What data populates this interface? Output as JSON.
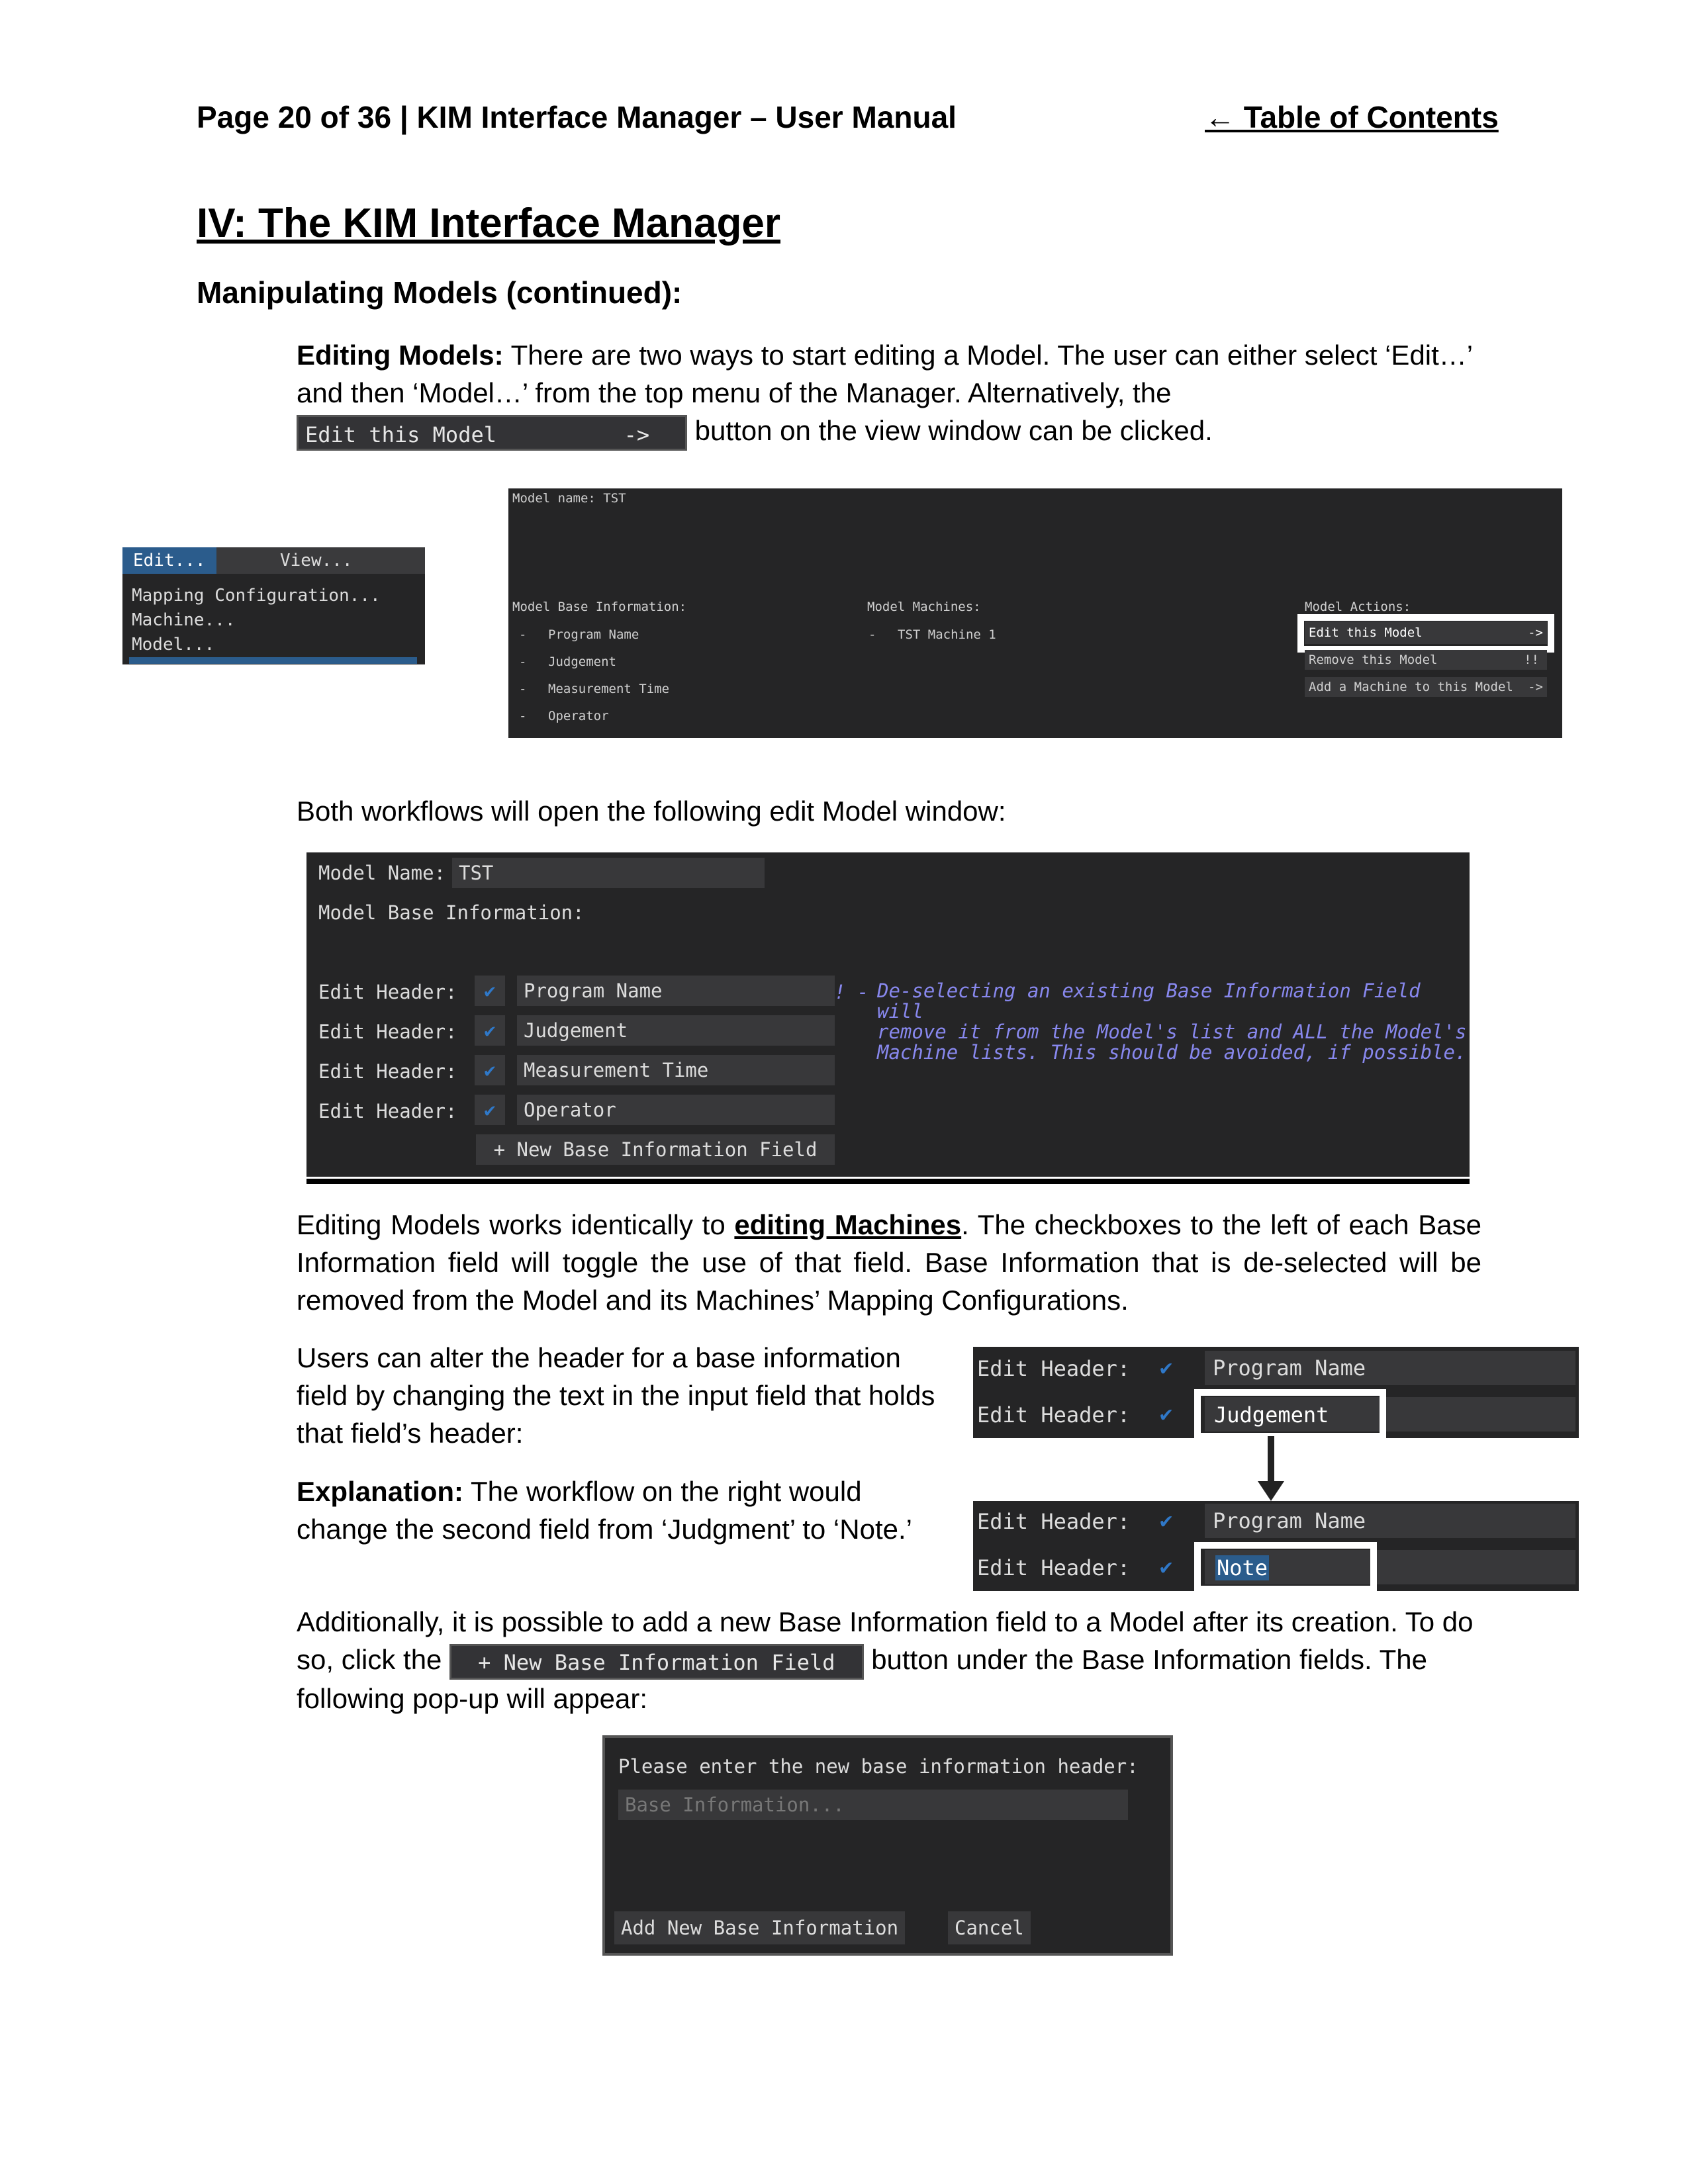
{
  "header": {
    "page_label": "Page 20 of 36 | KIM Interface Manager – User Manual",
    "toc_link": "← Table of Contents"
  },
  "section_title": "IV: The KIM Interface Manager",
  "subsection_title": "Manipulating Models (continued):",
  "editing_models": {
    "lead": "Editing Models:",
    "text1": " There are two ways to start editing a Model. The user can either select ‘Edit…’ and then ‘Model…’ from the top menu of the Manager. Alternatively, the",
    "inline_button": "Edit this Model          ->",
    "text2": " button on the view window can be clicked."
  },
  "edit_menu": {
    "tab_edit": "Edit...",
    "tab_view": "View...",
    "items": [
      "Mapping Configuration...",
      "Machine...",
      "Model..."
    ]
  },
  "view_window": {
    "model_name": "Model name: TST",
    "base_heading": "Model Base Information:",
    "base_items": [
      "Program Name",
      "Judgement",
      "Measurement Time",
      "Operator"
    ],
    "bullet": "-",
    "machines_heading": "Model Machines:",
    "machine_items": [
      "TST Machine 1"
    ],
    "actions_heading": "Model Actions:",
    "actions": [
      "Edit this Model",
      "Remove this Model",
      "Add a Machine to this Model"
    ],
    "action_suffixes": [
      "->",
      "!!",
      "->"
    ]
  },
  "both_workflows": "Both workflows will open the following edit Model window:",
  "edit_window": {
    "name_label": "Model Name:",
    "name_value": "TST",
    "base_heading": "Model Base Information:",
    "row_label": "Edit Header:",
    "rows": [
      "Program Name",
      "Judgement",
      "Measurement Time",
      "Operator"
    ],
    "check_glyph": "✔",
    "warning_prefix": "! -",
    "warning_lines": [
      "De-selecting an existing Base Information Field will",
      "remove it from the Model's list and ALL the Model's",
      "Machine lists. This should be avoided, if possible."
    ],
    "new_field_button": "+ New Base Information Field"
  },
  "identical_para": {
    "text1": "Editing Models works identically to ",
    "link": "editing Machines",
    "text2": ". The checkboxes to the left of each Base Information field will toggle the use of that field. Base Information that is de-selected will be removed from the Model and its Machines’ Mapping Configurations."
  },
  "alter_para": "Users can alter the header for a base information field by changing the text in the input field that holds that field’s header:",
  "explanation": {
    "lead": "Explanation:",
    "text": " The workflow on the right would change the second field from ‘Judgment’ to ‘Note.’"
  },
  "before_after": {
    "label": "Edit Header:",
    "before": [
      "Program Name",
      "Judgement"
    ],
    "after": [
      "Program Name",
      "Note"
    ]
  },
  "additionally": {
    "text1": "Additionally, it is possible to add a new Base Information field to a Model after its creation. To do so, click the",
    "button": "+ New Base Information Field",
    "text2": " button under the Base Information fields. The following pop-up will appear:"
  },
  "popup": {
    "prompt": "Please enter the new base information header:",
    "placeholder": "Base Information...",
    "add_button": "Add New Base Information",
    "cancel_button": "Cancel"
  },
  "colors": {
    "ui_background": "#252526",
    "ui_field": "#38383a",
    "check_blue": "#2f78c8",
    "menu_highlight": "#2b5c8c",
    "warning_text": "#8888ee"
  }
}
